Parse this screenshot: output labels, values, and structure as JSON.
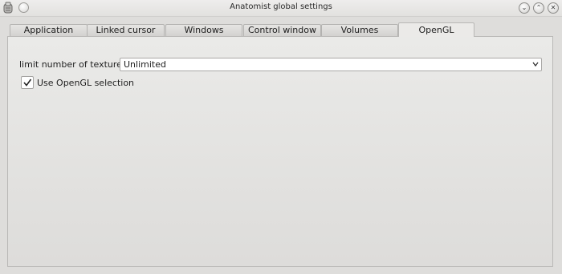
{
  "window": {
    "title": "Anatomist global settings"
  },
  "title_buttons": {
    "minimize": "⌄",
    "maximize": "⌃",
    "close": "✕"
  },
  "tabs": [
    {
      "label": "Application"
    },
    {
      "label": "Linked cursor"
    },
    {
      "label": "Windows"
    },
    {
      "label": "Control window"
    },
    {
      "label": "Volumes"
    },
    {
      "label": "OpenGL",
      "active": true
    }
  ],
  "opengl": {
    "textures_label": "limit number of textures:",
    "textures_value": "Unlimited",
    "selection_label": "Use OpenGL selection",
    "selection_checked": true
  },
  "colors": {
    "background": "#dedddb",
    "panel": "#eaeae8",
    "field": "#ffffff"
  },
  "icons": [
    "app-icon",
    "window-menu-icon",
    "minimize-icon",
    "maximize-icon",
    "close-icon",
    "chevron-down-icon",
    "checkmark-icon"
  ]
}
